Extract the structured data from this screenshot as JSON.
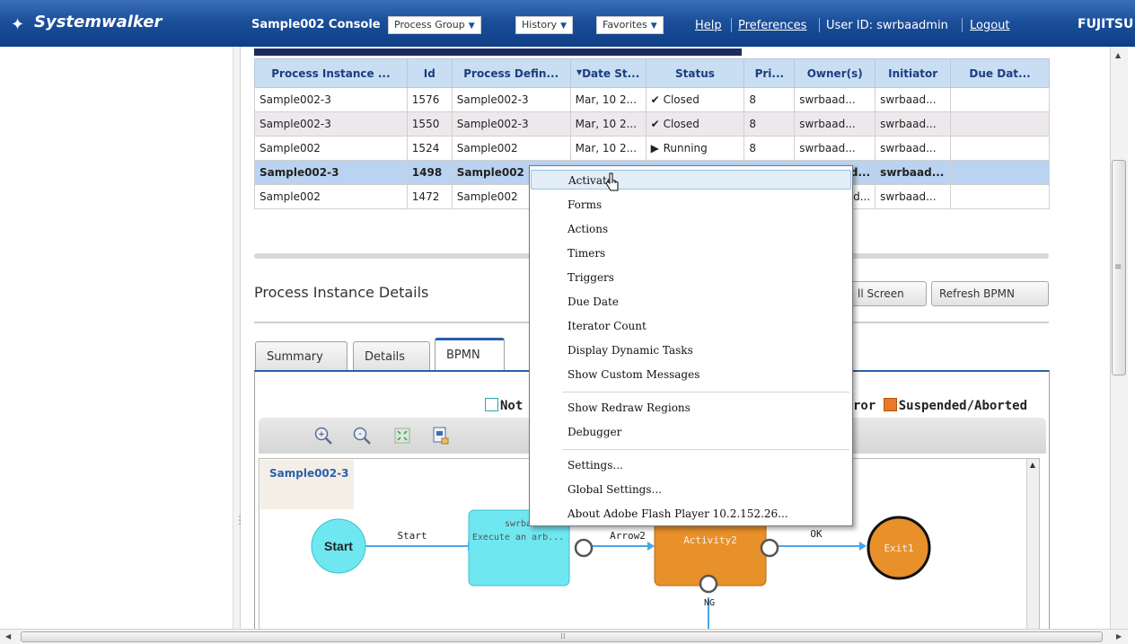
{
  "header": {
    "logo": "Systemwalker",
    "console_title": "Sample002 Console",
    "dropdowns": [
      "Process Group",
      "History",
      "Favorites"
    ],
    "help": "Help",
    "preferences": "Preferences",
    "user_id": "User ID: swrbaadmin",
    "logout": "Logout",
    "brand": "FUJITSU"
  },
  "table": {
    "columns": [
      "Process Instance ...",
      "Id",
      "Process Defin...",
      "Date St...",
      "Status",
      "Pri...",
      "Owner(s)",
      "Initiator",
      "Due Dat..."
    ],
    "rows": [
      {
        "instance": "Sample002-3",
        "id": "1576",
        "definition": "Sample002-3",
        "date": "Mar, 10 2...",
        "status": "Closed",
        "priority": "8",
        "owner": "swrbaad...",
        "initiator": "swrbaad...",
        "due": ""
      },
      {
        "instance": "Sample002-3",
        "id": "1550",
        "definition": "Sample002-3",
        "date": "Mar, 10 2...",
        "status": "Closed",
        "priority": "8",
        "owner": "swrbaad...",
        "initiator": "swrbaad...",
        "due": ""
      },
      {
        "instance": "Sample002",
        "id": "1524",
        "definition": "Sample002",
        "date": "Mar, 10 2...",
        "status": "Running",
        "priority": "8",
        "owner": "swrbaad...",
        "initiator": "swrbaad...",
        "due": ""
      },
      {
        "instance": "Sample002-3",
        "id": "1498",
        "definition": "Sample002",
        "date": "",
        "status": "",
        "priority": "",
        "owner": "ad...",
        "initiator": "swrbaad...",
        "due": ""
      },
      {
        "instance": "Sample002",
        "id": "1472",
        "definition": "Sample002",
        "date": "",
        "status": "",
        "priority": "",
        "owner": "ad...",
        "initiator": "swrbaad...",
        "due": ""
      }
    ]
  },
  "details": {
    "title": "Process Instance Details",
    "full_screen": "ll Screen",
    "refresh_bpmn": "Refresh BPMN"
  },
  "tabs": [
    "Summary",
    "Details",
    "BPMN"
  ],
  "legend": {
    "not": "Not",
    "error": "ror",
    "suspended": "Suspended/Aborted",
    "colors": {
      "not": "#6fd6e0",
      "suspended": "#e8782a"
    }
  },
  "canvas": {
    "process_name": "Sample002-3",
    "nodes": {
      "start": "Start",
      "task1_owner": "swrba",
      "task1_label": "Execute an arb...",
      "activity2": "Activity2",
      "exit1": "Exit1"
    },
    "edges": {
      "start": "Start",
      "arrow2": "Arrow2",
      "ok": "OK",
      "ng": "NG"
    }
  },
  "context_menu": {
    "items": [
      "Activate",
      "Forms",
      "Actions",
      "Timers",
      "Triggers",
      "Due Date",
      "Iterator Count",
      "Display Dynamic Tasks",
      "Show Custom Messages",
      "Show Redraw Regions",
      "Debugger",
      "Settings...",
      "Global Settings...",
      "About Adobe Flash Player 10.2.152.26..."
    ]
  },
  "colors": {
    "header_blue": "#1b4f9a",
    "header_col": "#c9def3",
    "selected_row": "#b9d3f0",
    "task_cyan": "#6fe7f0",
    "activity_orange": "#e8902a"
  }
}
